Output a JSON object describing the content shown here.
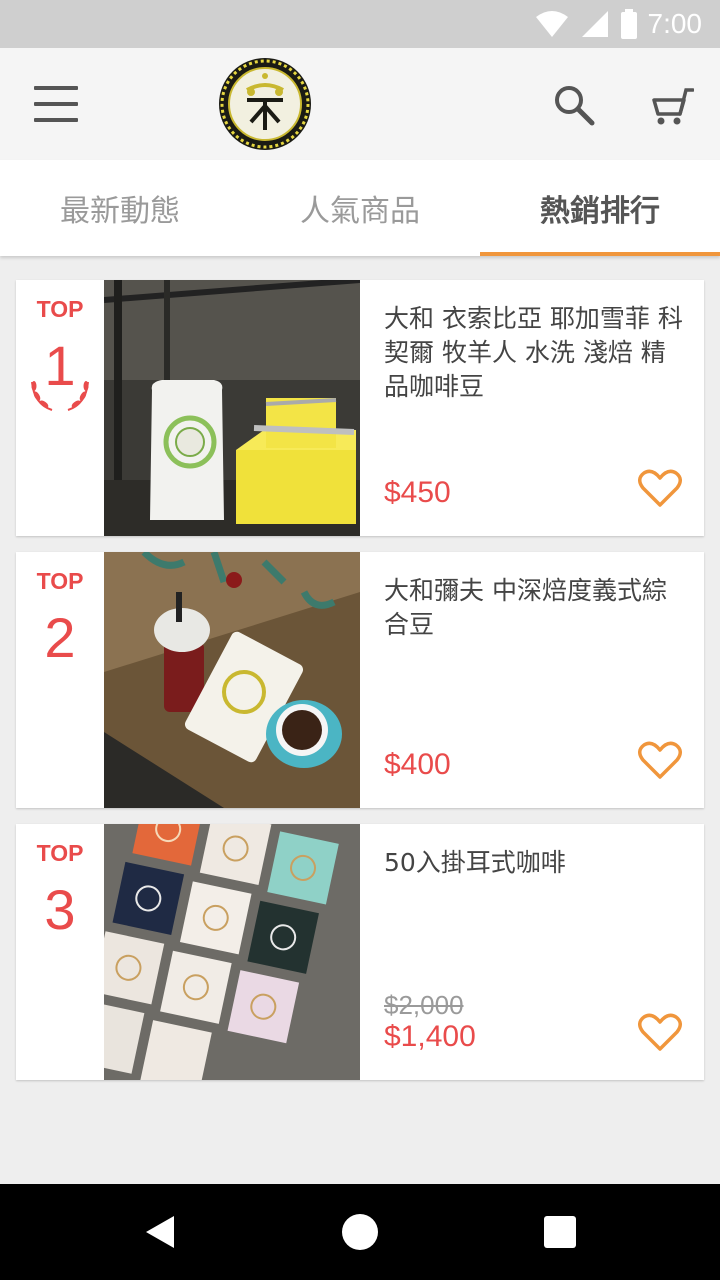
{
  "status_bar": {
    "time": "7:00"
  },
  "app_bar": {
    "logo": "brand-emblem-logo",
    "menu_icon": "hamburger-menu-icon",
    "search_icon": "search-icon",
    "cart_icon": "shopping-cart-icon"
  },
  "tabs": [
    {
      "label": "最新動態",
      "active": false
    },
    {
      "label": "人氣商品",
      "active": false
    },
    {
      "label": "熱銷排行",
      "active": true
    }
  ],
  "products": [
    {
      "rank_label": "TOP",
      "rank": "1",
      "title": "大和 衣索比亞 耶加雪菲 科契爾 牧羊人 水洗 淺焙 精品咖啡豆",
      "price": "$450",
      "price_old": ""
    },
    {
      "rank_label": "TOP",
      "rank": "2",
      "title": "大和彌夫 中深焙度義式綜合豆",
      "price": "$400",
      "price_old": ""
    },
    {
      "rank_label": "TOP",
      "rank": "3",
      "title": "50入掛耳式咖啡",
      "price": "$1,400",
      "price_old": "$2,000"
    }
  ],
  "colors": {
    "accent": "#f0963c",
    "price": "#e94b4b"
  }
}
